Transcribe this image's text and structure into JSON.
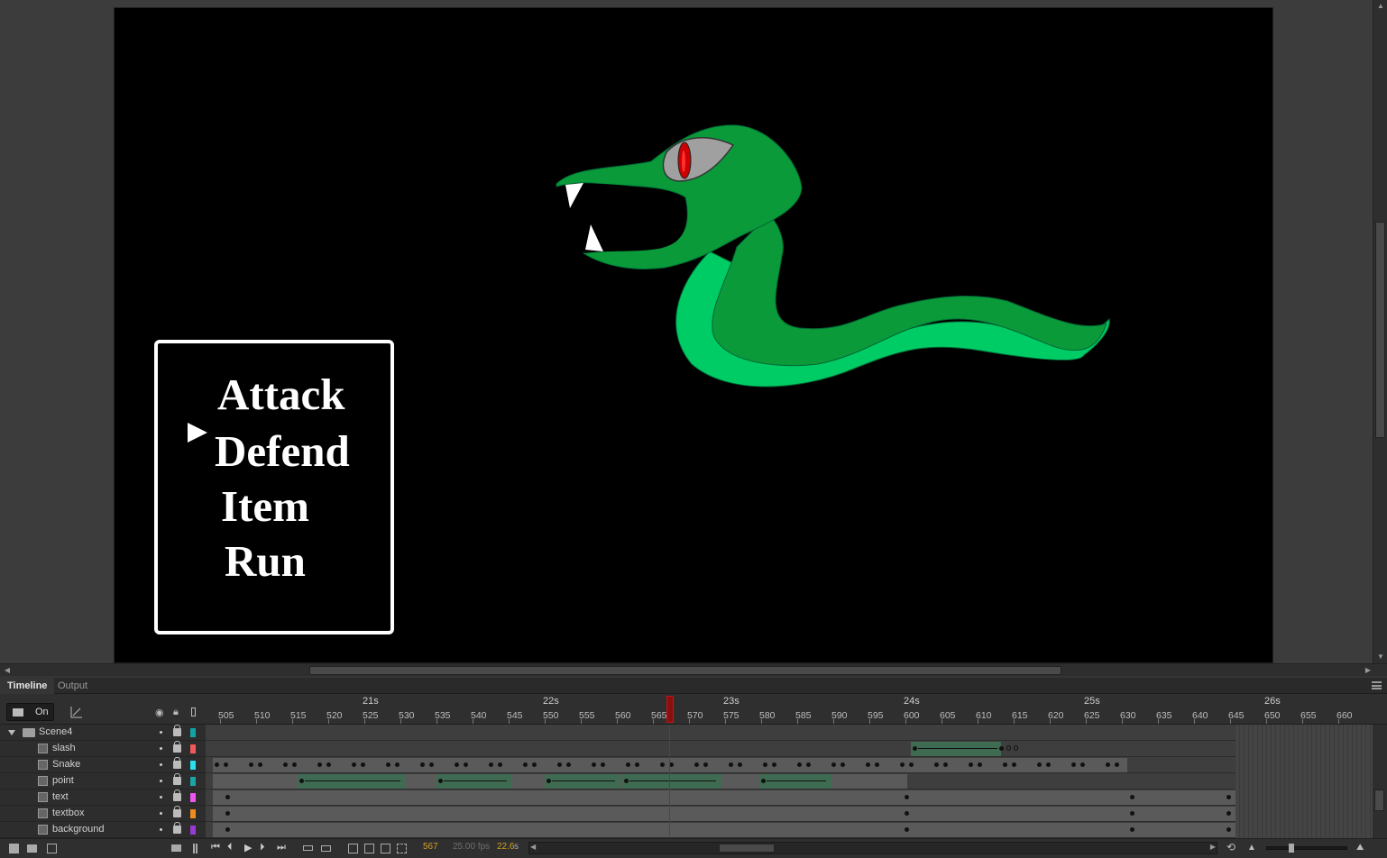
{
  "stage": {
    "menu": {
      "items": [
        "Attack",
        "Defend",
        "Item",
        "Run"
      ]
    }
  },
  "panel_tabs": [
    {
      "label": "Timeline",
      "active": true
    },
    {
      "label": "Output",
      "active": false
    }
  ],
  "timeline": {
    "onion_skin_label": "On",
    "seconds": [
      "21s",
      "22s",
      "23s",
      "24s",
      "25s",
      "26s"
    ],
    "frame_numbers": [
      "505",
      "510",
      "515",
      "520",
      "525",
      "530",
      "535",
      "540",
      "545",
      "550",
      "555",
      "560",
      "565",
      "570",
      "575",
      "580",
      "585",
      "590",
      "595",
      "600",
      "605",
      "610",
      "615",
      "620",
      "625",
      "630",
      "635",
      "640",
      "645",
      "650",
      "655",
      "660"
    ],
    "current_frame": "567",
    "fps": "25.00 fps",
    "elapsed_time": "22.6",
    "elapsed_unit": "s",
    "layers": [
      {
        "name": "Scene4",
        "type": "folder",
        "color": "#14a3a3"
      },
      {
        "name": "slash",
        "type": "layer",
        "color": "#f15a5a"
      },
      {
        "name": "Snake",
        "type": "layer",
        "color": "#28e0f0"
      },
      {
        "name": "point",
        "type": "layer",
        "color": "#1aa5a5"
      },
      {
        "name": "text",
        "type": "layer",
        "color": "#ee55ee"
      },
      {
        "name": "textbox",
        "type": "layer",
        "color": "#f08c1e"
      },
      {
        "name": "background",
        "type": "layer",
        "color": "#9a3ad6"
      }
    ]
  },
  "colors": {
    "snake_dark": "#0a9a3a",
    "snake_light": "#00cc66",
    "eye_red": "#cc0000",
    "playhead": "#c01515",
    "tween": "#3f6b52"
  }
}
